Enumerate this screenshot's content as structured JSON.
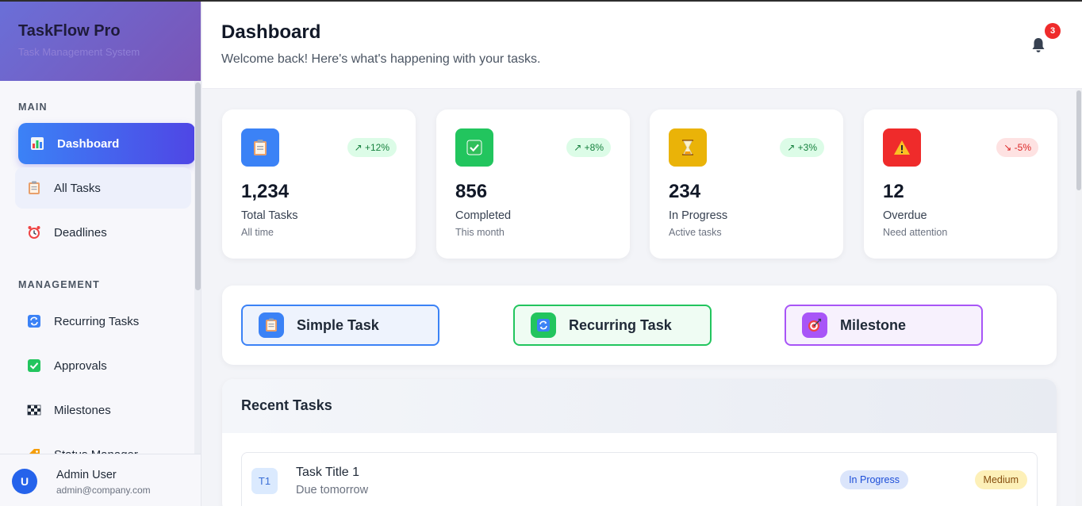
{
  "app": {
    "title": "TaskFlow Pro",
    "subtitle": "Task Management System"
  },
  "sidebar": {
    "sections": [
      {
        "label": "MAIN",
        "items": [
          {
            "label": "Dashboard",
            "icon": "chart-icon",
            "active": true
          },
          {
            "label": "All Tasks",
            "icon": "clipboard-icon"
          },
          {
            "label": "Deadlines",
            "icon": "alarm-clock-icon"
          }
        ]
      },
      {
        "label": "MANAGEMENT",
        "items": [
          {
            "label": "Recurring Tasks",
            "icon": "repeat-icon"
          },
          {
            "label": "Approvals",
            "icon": "check-box-icon"
          },
          {
            "label": "Milestones",
            "icon": "checkered-flag-icon"
          },
          {
            "label": "Status Manager",
            "icon": "tag-icon"
          }
        ]
      }
    ],
    "user": {
      "initial": "U",
      "name": "Admin User",
      "email": "admin@company.com"
    }
  },
  "header": {
    "title": "Dashboard",
    "subtitle": "Welcome back! Here's what's happening with your tasks.",
    "notifications": "3"
  },
  "stats": [
    {
      "value": "1,234",
      "label": "Total Tasks",
      "sub": "All time",
      "trend": "↗ +12%",
      "direction": "up",
      "color": "#3b82f6",
      "icon": "clipboard-icon"
    },
    {
      "value": "856",
      "label": "Completed",
      "sub": "This month",
      "trend": "↗ +8%",
      "direction": "up",
      "color": "#22c55e",
      "icon": "check-icon"
    },
    {
      "value": "234",
      "label": "In Progress",
      "sub": "Active tasks",
      "trend": "↗ +3%",
      "direction": "up",
      "color": "#eab308",
      "icon": "hourglass-icon"
    },
    {
      "value": "12",
      "label": "Overdue",
      "sub": "Need attention",
      "trend": "↘ -5%",
      "direction": "down",
      "color": "#ef4444",
      "icon": "warning-icon"
    }
  ],
  "task_types": [
    {
      "label": "Simple Task",
      "color": "#3b82f6",
      "icon": "clipboard-icon"
    },
    {
      "label": "Recurring Task",
      "color": "#22c55e",
      "icon": "repeat-icon"
    },
    {
      "label": "Milestone",
      "color": "#a855f7",
      "icon": "target-icon"
    }
  ],
  "recent": {
    "title": "Recent Tasks",
    "tasks": [
      {
        "badge": "T1",
        "title": "Task Title 1",
        "due": "Due tomorrow",
        "status": "In Progress",
        "priority": "Medium"
      }
    ]
  }
}
